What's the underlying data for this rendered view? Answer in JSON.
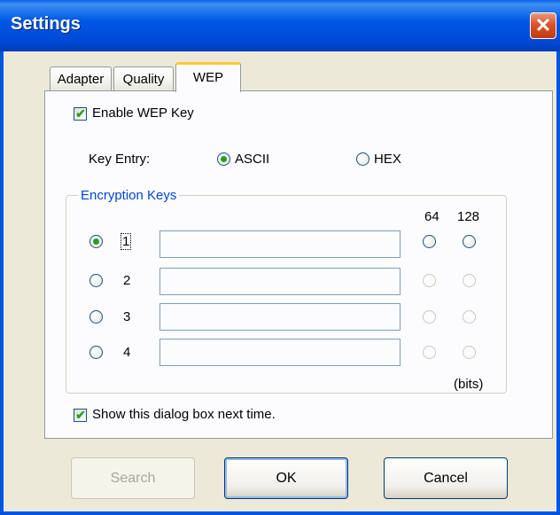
{
  "window": {
    "title": "Settings",
    "close_glyph": "✕"
  },
  "tabs": [
    {
      "label": "Adapter",
      "active": false
    },
    {
      "label": "Quality",
      "active": false
    },
    {
      "label": "WEP",
      "active": true
    }
  ],
  "wep": {
    "enable_label": "Enable WEP Key",
    "enable_checked": true,
    "key_entry_label": "Key Entry:",
    "ascii_label": "ASCII",
    "hex_label": "HEX",
    "selected_entry": "ASCII"
  },
  "encryption": {
    "group_label": "Encryption Keys",
    "col_64": "64",
    "col_128": "128",
    "bits_label": "(bits)",
    "keys": [
      {
        "number": "1",
        "value": "",
        "selected": true
      },
      {
        "number": "2",
        "value": "",
        "selected": false
      },
      {
        "number": "3",
        "value": "",
        "selected": false
      },
      {
        "number": "4",
        "value": "",
        "selected": false
      }
    ]
  },
  "show_dialog": {
    "label": "Show this dialog box next time.",
    "checked": true
  },
  "buttons": {
    "search": "Search",
    "ok": "OK",
    "cancel": "Cancel"
  },
  "colors": {
    "title_bar": "#0058e6",
    "accent_check": "#21a121",
    "group_label": "#0046d5"
  }
}
